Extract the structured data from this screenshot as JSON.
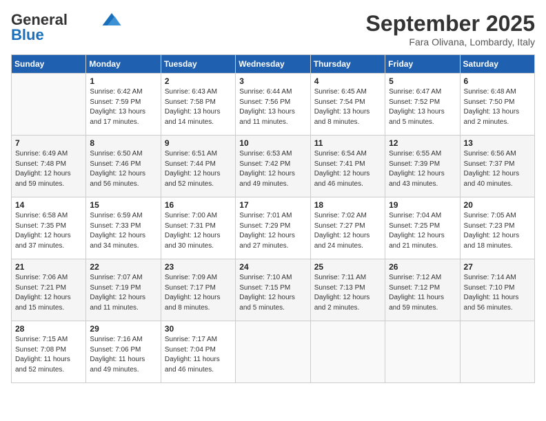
{
  "header": {
    "logo_general": "General",
    "logo_blue": "Blue",
    "month_title": "September 2025",
    "location": "Fara Olivana, Lombardy, Italy"
  },
  "weekdays": [
    "Sunday",
    "Monday",
    "Tuesday",
    "Wednesday",
    "Thursday",
    "Friday",
    "Saturday"
  ],
  "weeks": [
    [
      {
        "day": "",
        "info": ""
      },
      {
        "day": "1",
        "info": "Sunrise: 6:42 AM\nSunset: 7:59 PM\nDaylight: 13 hours\nand 17 minutes."
      },
      {
        "day": "2",
        "info": "Sunrise: 6:43 AM\nSunset: 7:58 PM\nDaylight: 13 hours\nand 14 minutes."
      },
      {
        "day": "3",
        "info": "Sunrise: 6:44 AM\nSunset: 7:56 PM\nDaylight: 13 hours\nand 11 minutes."
      },
      {
        "day": "4",
        "info": "Sunrise: 6:45 AM\nSunset: 7:54 PM\nDaylight: 13 hours\nand 8 minutes."
      },
      {
        "day": "5",
        "info": "Sunrise: 6:47 AM\nSunset: 7:52 PM\nDaylight: 13 hours\nand 5 minutes."
      },
      {
        "day": "6",
        "info": "Sunrise: 6:48 AM\nSunset: 7:50 PM\nDaylight: 13 hours\nand 2 minutes."
      }
    ],
    [
      {
        "day": "7",
        "info": "Sunrise: 6:49 AM\nSunset: 7:48 PM\nDaylight: 12 hours\nand 59 minutes."
      },
      {
        "day": "8",
        "info": "Sunrise: 6:50 AM\nSunset: 7:46 PM\nDaylight: 12 hours\nand 56 minutes."
      },
      {
        "day": "9",
        "info": "Sunrise: 6:51 AM\nSunset: 7:44 PM\nDaylight: 12 hours\nand 52 minutes."
      },
      {
        "day": "10",
        "info": "Sunrise: 6:53 AM\nSunset: 7:42 PM\nDaylight: 12 hours\nand 49 minutes."
      },
      {
        "day": "11",
        "info": "Sunrise: 6:54 AM\nSunset: 7:41 PM\nDaylight: 12 hours\nand 46 minutes."
      },
      {
        "day": "12",
        "info": "Sunrise: 6:55 AM\nSunset: 7:39 PM\nDaylight: 12 hours\nand 43 minutes."
      },
      {
        "day": "13",
        "info": "Sunrise: 6:56 AM\nSunset: 7:37 PM\nDaylight: 12 hours\nand 40 minutes."
      }
    ],
    [
      {
        "day": "14",
        "info": "Sunrise: 6:58 AM\nSunset: 7:35 PM\nDaylight: 12 hours\nand 37 minutes."
      },
      {
        "day": "15",
        "info": "Sunrise: 6:59 AM\nSunset: 7:33 PM\nDaylight: 12 hours\nand 34 minutes."
      },
      {
        "day": "16",
        "info": "Sunrise: 7:00 AM\nSunset: 7:31 PM\nDaylight: 12 hours\nand 30 minutes."
      },
      {
        "day": "17",
        "info": "Sunrise: 7:01 AM\nSunset: 7:29 PM\nDaylight: 12 hours\nand 27 minutes."
      },
      {
        "day": "18",
        "info": "Sunrise: 7:02 AM\nSunset: 7:27 PM\nDaylight: 12 hours\nand 24 minutes."
      },
      {
        "day": "19",
        "info": "Sunrise: 7:04 AM\nSunset: 7:25 PM\nDaylight: 12 hours\nand 21 minutes."
      },
      {
        "day": "20",
        "info": "Sunrise: 7:05 AM\nSunset: 7:23 PM\nDaylight: 12 hours\nand 18 minutes."
      }
    ],
    [
      {
        "day": "21",
        "info": "Sunrise: 7:06 AM\nSunset: 7:21 PM\nDaylight: 12 hours\nand 15 minutes."
      },
      {
        "day": "22",
        "info": "Sunrise: 7:07 AM\nSunset: 7:19 PM\nDaylight: 12 hours\nand 11 minutes."
      },
      {
        "day": "23",
        "info": "Sunrise: 7:09 AM\nSunset: 7:17 PM\nDaylight: 12 hours\nand 8 minutes."
      },
      {
        "day": "24",
        "info": "Sunrise: 7:10 AM\nSunset: 7:15 PM\nDaylight: 12 hours\nand 5 minutes."
      },
      {
        "day": "25",
        "info": "Sunrise: 7:11 AM\nSunset: 7:13 PM\nDaylight: 12 hours\nand 2 minutes."
      },
      {
        "day": "26",
        "info": "Sunrise: 7:12 AM\nSunset: 7:12 PM\nDaylight: 11 hours\nand 59 minutes."
      },
      {
        "day": "27",
        "info": "Sunrise: 7:14 AM\nSunset: 7:10 PM\nDaylight: 11 hours\nand 56 minutes."
      }
    ],
    [
      {
        "day": "28",
        "info": "Sunrise: 7:15 AM\nSunset: 7:08 PM\nDaylight: 11 hours\nand 52 minutes."
      },
      {
        "day": "29",
        "info": "Sunrise: 7:16 AM\nSunset: 7:06 PM\nDaylight: 11 hours\nand 49 minutes."
      },
      {
        "day": "30",
        "info": "Sunrise: 7:17 AM\nSunset: 7:04 PM\nDaylight: 11 hours\nand 46 minutes."
      },
      {
        "day": "",
        "info": ""
      },
      {
        "day": "",
        "info": ""
      },
      {
        "day": "",
        "info": ""
      },
      {
        "day": "",
        "info": ""
      }
    ]
  ]
}
